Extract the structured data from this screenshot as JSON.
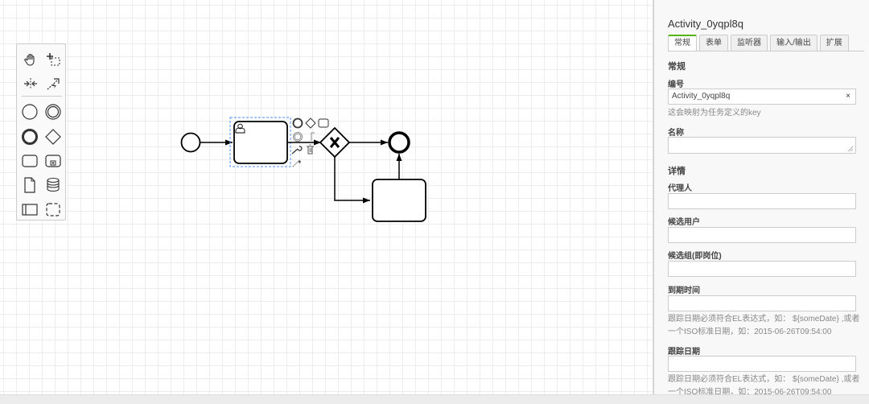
{
  "palette": {
    "tools": [
      {
        "name": "hand-tool-icon"
      },
      {
        "name": "lasso-tool-icon"
      },
      {
        "name": "space-tool-icon"
      },
      {
        "name": "global-connect-tool-icon"
      }
    ],
    "shapes": [
      {
        "name": "start-event-icon"
      },
      {
        "name": "intermediate-event-icon"
      },
      {
        "name": "end-event-icon"
      },
      {
        "name": "gateway-icon"
      },
      {
        "name": "task-icon"
      },
      {
        "name": "subprocess-icon"
      },
      {
        "name": "data-object-icon"
      },
      {
        "name": "data-store-icon"
      },
      {
        "name": "pool-icon"
      },
      {
        "name": "group-icon"
      }
    ]
  },
  "panel": {
    "title": "Activity_0yqpl8q",
    "tabs": [
      "常规",
      "表单",
      "监听器",
      "输入/输出",
      "扩展"
    ],
    "active_tab": "常规",
    "general_section": "常规",
    "id_label": "编号",
    "id_value": "Activity_0yqpl8q",
    "id_clear": "×",
    "id_hint": "这会映射为任务定义的key",
    "name_label": "名称",
    "name_value": "",
    "details_section": "详情",
    "assignee_label": "代理人",
    "candidate_users_label": "候选用户",
    "candidate_groups_label": "候选组(即岗位)",
    "due_date_label": "到期时间",
    "due_date_hint": "跟踪日期必须符合EL表达式，如： ${someDate} ,或者一个ISO标准日期，如：2015-06-26T09:54:00",
    "follow_up_label": "跟踪日期",
    "follow_up_hint": "跟踪日期必须符合EL表达式，如： ${someDate} ,或者一个ISO标准日期，如：2015-06-26T09:54:00"
  },
  "colors": {
    "accent": "#52b415",
    "selection": "#4d90fe",
    "stroke": "#000000"
  }
}
